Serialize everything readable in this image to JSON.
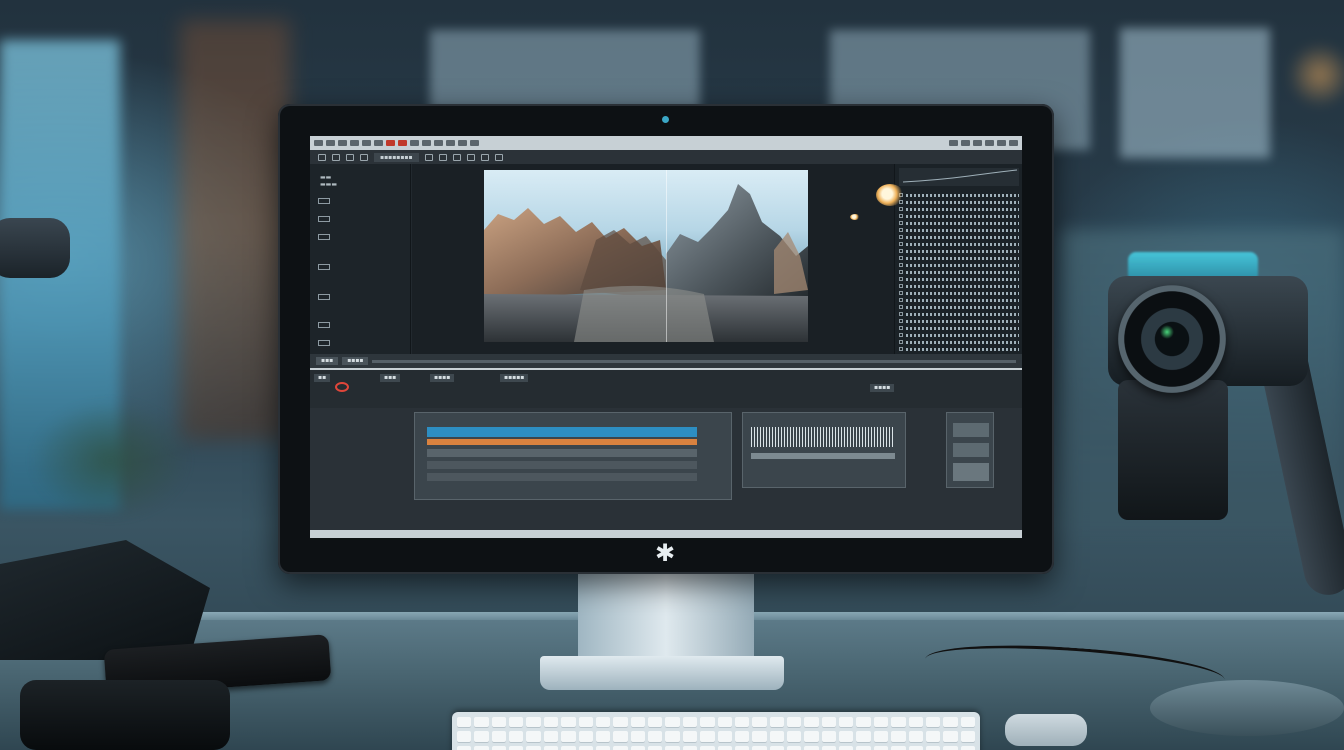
{
  "scene": {
    "subject": "desktop-monitor-video-editor",
    "colors": {
      "accent_teal": "#3ba7c6",
      "record_red": "#e0463a",
      "clip_blue": "#2d8ec2",
      "clip_orange": "#d9823f",
      "ui_dark": "#22292f",
      "ui_light": "#c7d0d5"
    },
    "icons": {
      "monitor_logo": "asterisk-logo-icon",
      "webcam": "webcam-icon",
      "record_marker": "record-icon"
    },
    "monitor_logo_glyph": "✱"
  }
}
